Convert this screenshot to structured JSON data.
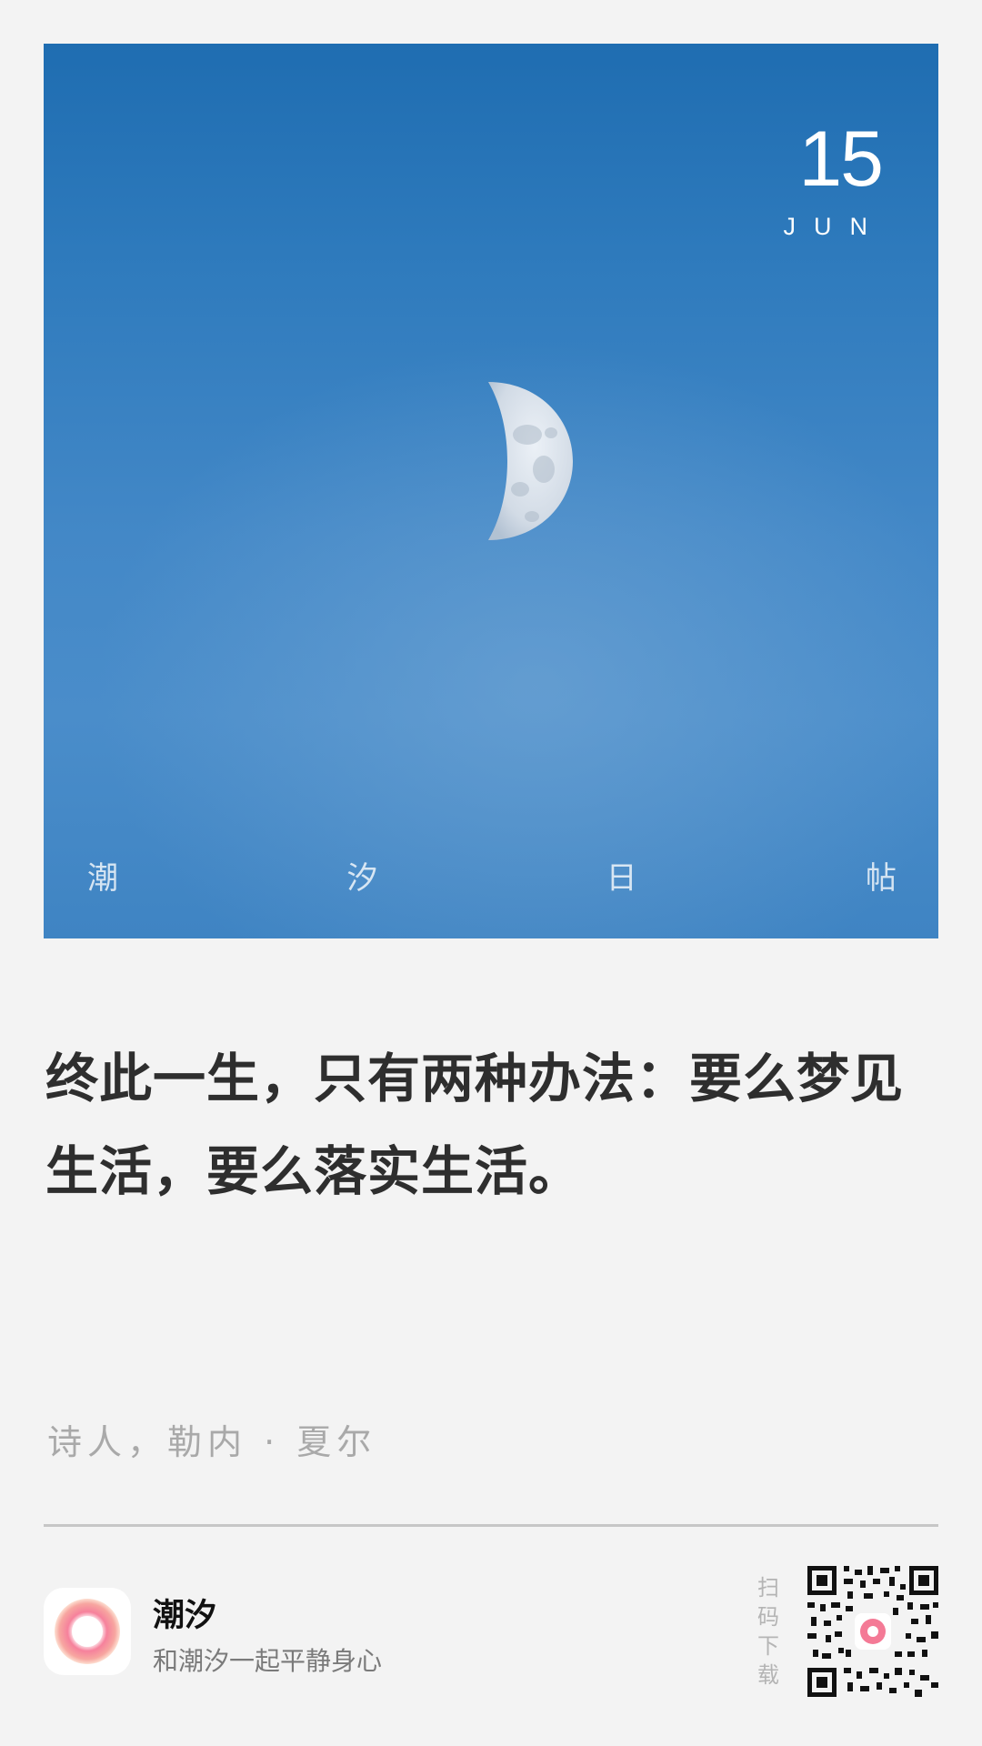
{
  "card": {
    "date": {
      "day": "15",
      "month": "JUN"
    },
    "brand_chars": [
      "潮",
      "汐",
      "日",
      "帖"
    ],
    "quote": "终此一生，只有两种办法：要么梦见生活，要么落实生活。",
    "author": "诗人，勒内 · 夏尔"
  },
  "footer": {
    "app_name": "潮汐",
    "tagline": "和潮汐一起平静身心",
    "scan_label": "扫码下载"
  },
  "colors": {
    "sky_top": "#1f6db1",
    "sky_bottom": "#4a8dca",
    "background": "#f3f3f3",
    "quote_text": "#2e2e2e",
    "author_text": "#a9a9a9",
    "logo_pink": "#f47a96"
  }
}
